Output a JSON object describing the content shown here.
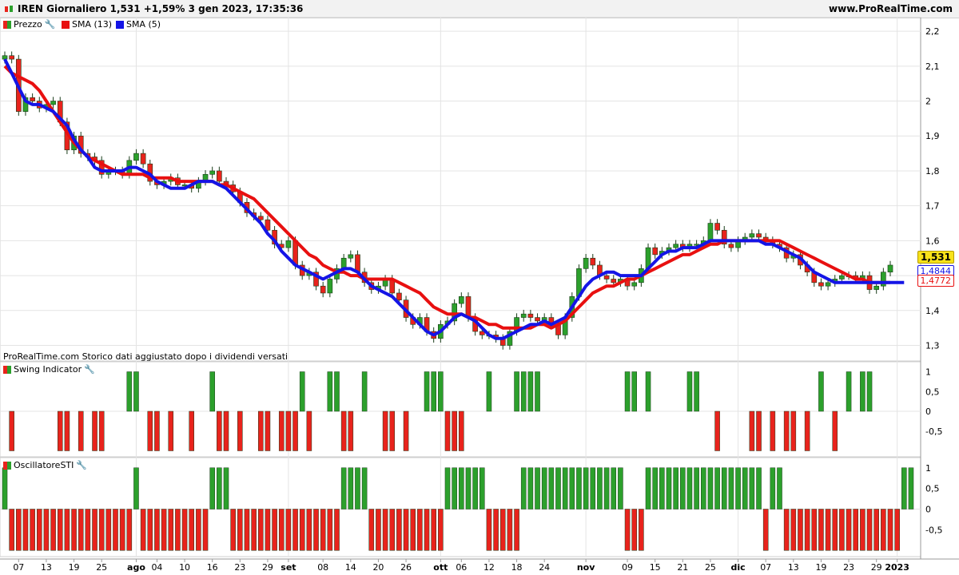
{
  "header": {
    "title": "IREN Giornaliero 1,531 +1,59% 3 gen 2023, 17:35:36",
    "site": "www.ProRealTime.com"
  },
  "legend": {
    "price": "Prezzo",
    "sma13": "SMA (13)",
    "sma5": "SMA (5)"
  },
  "note": "ProRealTime.com Storico dati aggiustato dopo i dividendi versati",
  "price_tags": {
    "last": "1,531",
    "sma5": "1,4844",
    "sma13": "1,4772"
  },
  "panels": {
    "swing": "Swing Indicator",
    "osc": "OscillatoreSTI"
  },
  "colors": {
    "up": "#2ca02c",
    "down": "#e8231c",
    "sma13": "#e81010",
    "sma5": "#1414e6",
    "grid": "#e4e4e4",
    "last_tag": "#f7e21a"
  },
  "x_labels": [
    {
      "label": "07",
      "bar": 2
    },
    {
      "label": "13",
      "bar": 6
    },
    {
      "label": "19",
      "bar": 10
    },
    {
      "label": "25",
      "bar": 14
    },
    {
      "label": "ago",
      "bar": 19,
      "bold": true
    },
    {
      "label": "04",
      "bar": 22
    },
    {
      "label": "10",
      "bar": 26
    },
    {
      "label": "16",
      "bar": 30
    },
    {
      "label": "23",
      "bar": 34
    },
    {
      "label": "29",
      "bar": 38
    },
    {
      "label": "set",
      "bar": 41,
      "bold": true
    },
    {
      "label": "08",
      "bar": 46
    },
    {
      "label": "14",
      "bar": 50
    },
    {
      "label": "20",
      "bar": 54
    },
    {
      "label": "26",
      "bar": 58
    },
    {
      "label": "ott",
      "bar": 63,
      "bold": true
    },
    {
      "label": "06",
      "bar": 66
    },
    {
      "label": "12",
      "bar": 70
    },
    {
      "label": "18",
      "bar": 74
    },
    {
      "label": "24",
      "bar": 78
    },
    {
      "label": "nov",
      "bar": 84,
      "bold": true
    },
    {
      "label": "09",
      "bar": 90
    },
    {
      "label": "15",
      "bar": 94
    },
    {
      "label": "21",
      "bar": 98
    },
    {
      "label": "25",
      "bar": 102
    },
    {
      "label": "dic",
      "bar": 106,
      "bold": true
    },
    {
      "label": "07",
      "bar": 110
    },
    {
      "label": "13",
      "bar": 114
    },
    {
      "label": "19",
      "bar": 118
    },
    {
      "label": "23",
      "bar": 122
    },
    {
      "label": "29",
      "bar": 126
    },
    {
      "label": "2023",
      "bar": 129,
      "bold": true
    }
  ],
  "chart_data": [
    {
      "type": "candlestick",
      "title": "IREN Giornaliero",
      "y_ticks": [
        1.3,
        1.4,
        1.5,
        1.6,
        1.7,
        1.8,
        1.9,
        2.0,
        2.1,
        2.2
      ],
      "y_tick_labels": [
        "1,3",
        "1,4",
        "1,5",
        "1,6",
        "1,7",
        "1,8",
        "1,9",
        "2",
        "2,1",
        "2,2"
      ],
      "ylim": [
        1.26,
        2.23
      ],
      "series": [
        {
          "name": "SMA (13)"
        },
        {
          "name": "SMA (5)"
        }
      ],
      "close": [
        2.13,
        2.12,
        1.97,
        2.01,
        2.0,
        1.98,
        1.99,
        2.0,
        1.94,
        1.86,
        1.9,
        1.85,
        1.84,
        1.83,
        1.79,
        1.8,
        1.8,
        1.79,
        1.83,
        1.85,
        1.82,
        1.77,
        1.76,
        1.77,
        1.78,
        1.76,
        1.76,
        1.75,
        1.77,
        1.79,
        1.8,
        1.77,
        1.76,
        1.74,
        1.71,
        1.68,
        1.67,
        1.66,
        1.63,
        1.59,
        1.58,
        1.6,
        1.53,
        1.5,
        1.51,
        1.47,
        1.45,
        1.49,
        1.52,
        1.55,
        1.56,
        1.51,
        1.48,
        1.46,
        1.47,
        1.49,
        1.45,
        1.43,
        1.38,
        1.36,
        1.38,
        1.34,
        1.32,
        1.36,
        1.37,
        1.42,
        1.44,
        1.38,
        1.34,
        1.33,
        1.33,
        1.32,
        1.3,
        1.34,
        1.38,
        1.39,
        1.38,
        1.37,
        1.38,
        1.36,
        1.33,
        1.38,
        1.44,
        1.52,
        1.55,
        1.53,
        1.5,
        1.49,
        1.48,
        1.49,
        1.47,
        1.48,
        1.52,
        1.58,
        1.56,
        1.57,
        1.58,
        1.59,
        1.58,
        1.59,
        1.59,
        1.6,
        1.65,
        1.63,
        1.59,
        1.58,
        1.6,
        1.61,
        1.62,
        1.61,
        1.6,
        1.59,
        1.58,
        1.55,
        1.56,
        1.53,
        1.51,
        1.48,
        1.47,
        1.48,
        1.49,
        1.5,
        1.5,
        1.49,
        1.5,
        1.46,
        1.47,
        1.51,
        1.53
      ],
      "sma13": [
        2.1,
        2.08,
        2.07,
        2.06,
        2.05,
        2.03,
        2.0,
        1.97,
        1.94,
        1.91,
        1.88,
        1.86,
        1.84,
        1.83,
        1.82,
        1.81,
        1.8,
        1.79,
        1.79,
        1.79,
        1.79,
        1.78,
        1.78,
        1.78,
        1.78,
        1.77,
        1.77,
        1.77,
        1.77,
        1.77,
        1.77,
        1.76,
        1.76,
        1.75,
        1.74,
        1.73,
        1.72,
        1.7,
        1.68,
        1.66,
        1.64,
        1.62,
        1.6,
        1.58,
        1.56,
        1.55,
        1.53,
        1.52,
        1.51,
        1.51,
        1.5,
        1.5,
        1.49,
        1.49,
        1.49,
        1.49,
        1.49,
        1.48,
        1.47,
        1.46,
        1.45,
        1.43,
        1.41,
        1.4,
        1.39,
        1.39,
        1.39,
        1.38,
        1.38,
        1.37,
        1.36,
        1.36,
        1.35,
        1.35,
        1.35,
        1.35,
        1.35,
        1.36,
        1.36,
        1.35,
        1.36,
        1.37,
        1.39,
        1.41,
        1.43,
        1.45,
        1.46,
        1.47,
        1.47,
        1.48,
        1.49,
        1.49,
        1.5,
        1.51,
        1.52,
        1.53,
        1.54,
        1.55,
        1.56,
        1.56,
        1.57,
        1.58,
        1.59,
        1.59,
        1.6,
        1.6,
        1.6,
        1.6,
        1.6,
        1.6,
        1.6,
        1.6,
        1.6,
        1.59,
        1.58,
        1.57,
        1.56,
        1.55,
        1.54,
        1.53,
        1.52,
        1.51,
        1.5,
        1.49,
        1.49,
        1.48,
        1.48,
        1.48,
        1.48
      ],
      "sma5": [
        2.12,
        2.08,
        2.04,
        2.0,
        1.99,
        1.99,
        1.98,
        1.97,
        1.95,
        1.93,
        1.89,
        1.86,
        1.84,
        1.81,
        1.8,
        1.8,
        1.8,
        1.8,
        1.81,
        1.81,
        1.8,
        1.79,
        1.77,
        1.76,
        1.75,
        1.75,
        1.75,
        1.76,
        1.77,
        1.77,
        1.77,
        1.76,
        1.75,
        1.73,
        1.71,
        1.69,
        1.67,
        1.65,
        1.62,
        1.6,
        1.57,
        1.55,
        1.53,
        1.52,
        1.51,
        1.5,
        1.49,
        1.5,
        1.51,
        1.52,
        1.52,
        1.51,
        1.49,
        1.47,
        1.46,
        1.45,
        1.44,
        1.42,
        1.4,
        1.38,
        1.36,
        1.34,
        1.33,
        1.34,
        1.36,
        1.38,
        1.39,
        1.38,
        1.37,
        1.35,
        1.33,
        1.32,
        1.32,
        1.33,
        1.34,
        1.35,
        1.36,
        1.36,
        1.37,
        1.36,
        1.37,
        1.38,
        1.41,
        1.44,
        1.47,
        1.49,
        1.5,
        1.51,
        1.51,
        1.5,
        1.5,
        1.5,
        1.5,
        1.52,
        1.54,
        1.56,
        1.57,
        1.57,
        1.58,
        1.58,
        1.58,
        1.59,
        1.6,
        1.6,
        1.6,
        1.6,
        1.6,
        1.6,
        1.6,
        1.6,
        1.59,
        1.59,
        1.58,
        1.57,
        1.56,
        1.55,
        1.53,
        1.51,
        1.5,
        1.49,
        1.48,
        1.48,
        1.48,
        1.48,
        1.48,
        1.48,
        1.48,
        1.48,
        1.48,
        1.48,
        1.48
      ]
    },
    {
      "type": "bar",
      "title": "Swing Indicator",
      "y_ticks": [
        1,
        0.5,
        0,
        -0.5
      ],
      "y_tick_labels": [
        "1",
        "0,5",
        "0",
        "-0,5"
      ],
      "values": [
        0,
        -1,
        0,
        0,
        0,
        0,
        0,
        0,
        -1,
        -1,
        0,
        -1,
        0,
        -1,
        -1,
        0,
        0,
        0,
        1,
        1,
        0,
        -1,
        -1,
        0,
        -1,
        0,
        0,
        -1,
        0,
        0,
        1,
        -1,
        -1,
        0,
        -1,
        0,
        0,
        -1,
        -1,
        0,
        -1,
        -1,
        -1,
        1,
        -1,
        0,
        0,
        1,
        1,
        -1,
        -1,
        0,
        1,
        0,
        0,
        -1,
        -1,
        0,
        -1,
        0,
        0,
        1,
        1,
        1,
        -1,
        -1,
        -1,
        0,
        0,
        0,
        1,
        0,
        0,
        0,
        1,
        1,
        1,
        1,
        0,
        0,
        0,
        0,
        0,
        0,
        0,
        0,
        0,
        0,
        0,
        0,
        1,
        1,
        0,
        1,
        0,
        0,
        0,
        0,
        0,
        1,
        1,
        0,
        0,
        -1,
        0,
        0,
        0,
        0,
        -1,
        -1,
        0,
        -1,
        0,
        -1,
        -1,
        0,
        -1,
        0,
        1,
        0,
        -1,
        0,
        1,
        0,
        1,
        1
      ],
      "ylim": [
        -1,
        1
      ]
    },
    {
      "type": "bar",
      "title": "OscillatoreSTI",
      "y_ticks": [
        1,
        0.5,
        0,
        -0.5
      ],
      "y_tick_labels": [
        "1",
        "0,5",
        "0",
        "-0,5"
      ],
      "values": [
        1,
        -1,
        -1,
        -1,
        -1,
        -1,
        -1,
        -1,
        -1,
        -1,
        -1,
        -1,
        -1,
        -1,
        -1,
        -1,
        -1,
        -1,
        -1,
        1,
        -1,
        -1,
        -1,
        -1,
        -1,
        -1,
        -1,
        -1,
        -1,
        -1,
        1,
        1,
        1,
        -1,
        -1,
        -1,
        -1,
        -1,
        -1,
        -1,
        -1,
        -1,
        -1,
        -1,
        -1,
        -1,
        -1,
        -1,
        -1,
        1,
        1,
        1,
        1,
        -1,
        -1,
        -1,
        -1,
        -1,
        -1,
        -1,
        -1,
        -1,
        -1,
        -1,
        1,
        1,
        1,
        1,
        1,
        1,
        -1,
        -1,
        -1,
        -1,
        -1,
        1,
        1,
        1,
        1,
        1,
        1,
        1,
        1,
        1,
        1,
        1,
        1,
        1,
        1,
        1,
        -1,
        -1,
        -1,
        1,
        1,
        1,
        1,
        1,
        1,
        1,
        1,
        1,
        1,
        1,
        1,
        1,
        1,
        1,
        1,
        1,
        -1,
        1,
        1,
        -1,
        -1,
        -1,
        -1,
        -1,
        -1,
        -1,
        -1,
        -1,
        -1,
        -1,
        -1,
        -1,
        -1,
        -1,
        -1,
        -1,
        1,
        1
      ],
      "ylim": [
        -1,
        1
      ]
    }
  ]
}
